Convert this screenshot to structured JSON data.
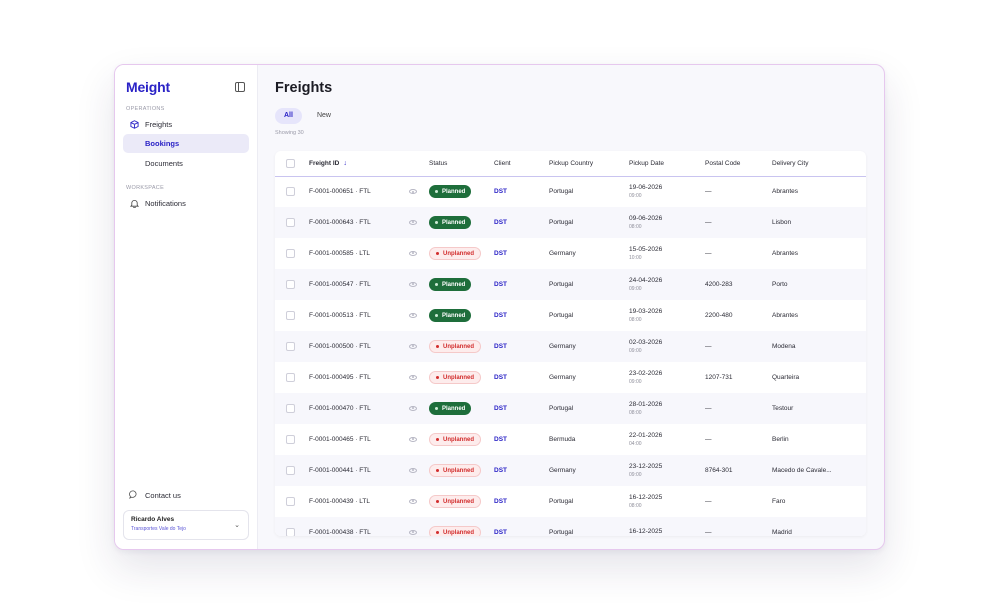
{
  "app": {
    "brand": "Meight"
  },
  "sidebar": {
    "operations_label": "OPERATIONS",
    "freights_label": "Freights",
    "bookings_label": "Bookings",
    "documents_label": "Documents",
    "workspace_label": "WORKSPACE",
    "notifications_label": "Notifications",
    "contact_label": "Contact us",
    "user": {
      "name": "Ricardo Alves",
      "company": "Transportes Vale do Tejo"
    }
  },
  "main": {
    "title": "Freights",
    "tabs": [
      {
        "label": "All",
        "active": true
      },
      {
        "label": "New",
        "active": false
      }
    ],
    "showing": "Showing 30"
  },
  "table": {
    "columns": [
      "Freight ID",
      "Status",
      "Client",
      "Pickup Country",
      "Pickup Date",
      "Postal Code",
      "Delivery City"
    ],
    "rows": [
      {
        "id": "F-0001-000651 · FTL",
        "status": "Planned",
        "client": "DST",
        "country": "Portugal",
        "date": "19-06-2026",
        "time": "09:00",
        "postal": "—",
        "city": "Abrantes"
      },
      {
        "id": "F-0001-000643 · FTL",
        "status": "Planned",
        "client": "DST",
        "country": "Portugal",
        "date": "09-06-2026",
        "time": "08:00",
        "postal": "—",
        "city": "Lisbon"
      },
      {
        "id": "F-0001-000585 · LTL",
        "status": "Unplanned",
        "client": "DST",
        "country": "Germany",
        "date": "15-05-2026",
        "time": "10:00",
        "postal": "—",
        "city": "Abrantes"
      },
      {
        "id": "F-0001-000547 · FTL",
        "status": "Planned",
        "client": "DST",
        "country": "Portugal",
        "date": "24-04-2026",
        "time": "09:00",
        "postal": "4200-283",
        "city": "Porto"
      },
      {
        "id": "F-0001-000513 · FTL",
        "status": "Planned",
        "client": "DST",
        "country": "Portugal",
        "date": "19-03-2026",
        "time": "08:00",
        "postal": "2200-480",
        "city": "Abrantes"
      },
      {
        "id": "F-0001-000500 · FTL",
        "status": "Unplanned",
        "client": "DST",
        "country": "Germany",
        "date": "02-03-2026",
        "time": "09:00",
        "postal": "—",
        "city": "Modena"
      },
      {
        "id": "F-0001-000495 · FTL",
        "status": "Unplanned",
        "client": "DST",
        "country": "Germany",
        "date": "23-02-2026",
        "time": "09:00",
        "postal": "1207-731",
        "city": "Quarteira"
      },
      {
        "id": "F-0001-000470 · FTL",
        "status": "Planned",
        "client": "DST",
        "country": "Portugal",
        "date": "28-01-2026",
        "time": "08:00",
        "postal": "—",
        "city": "Testour"
      },
      {
        "id": "F-0001-000465 · FTL",
        "status": "Unplanned",
        "client": "DST",
        "country": "Bermuda",
        "date": "22-01-2026",
        "time": "04:00",
        "postal": "—",
        "city": "Berlin"
      },
      {
        "id": "F-0001-000441 · FTL",
        "status": "Unplanned",
        "client": "DST",
        "country": "Germany",
        "date": "23-12-2025",
        "time": "09:00",
        "postal": "8764-301",
        "city": "Macedo de Cavale..."
      },
      {
        "id": "F-0001-000439 · LTL",
        "status": "Unplanned",
        "client": "DST",
        "country": "Portugal",
        "date": "16-12-2025",
        "time": "08:00",
        "postal": "—",
        "city": "Faro"
      },
      {
        "id": "F-0001-000438 · FTL",
        "status": "Unplanned",
        "client": "DST",
        "country": "Portugal",
        "date": "16-12-2025",
        "time": "",
        "postal": "—",
        "city": "Madrid"
      }
    ]
  },
  "colors": {
    "brand": "#2a22c6",
    "planned": "#1e6e3b",
    "unplanned": "#d22d2d"
  }
}
